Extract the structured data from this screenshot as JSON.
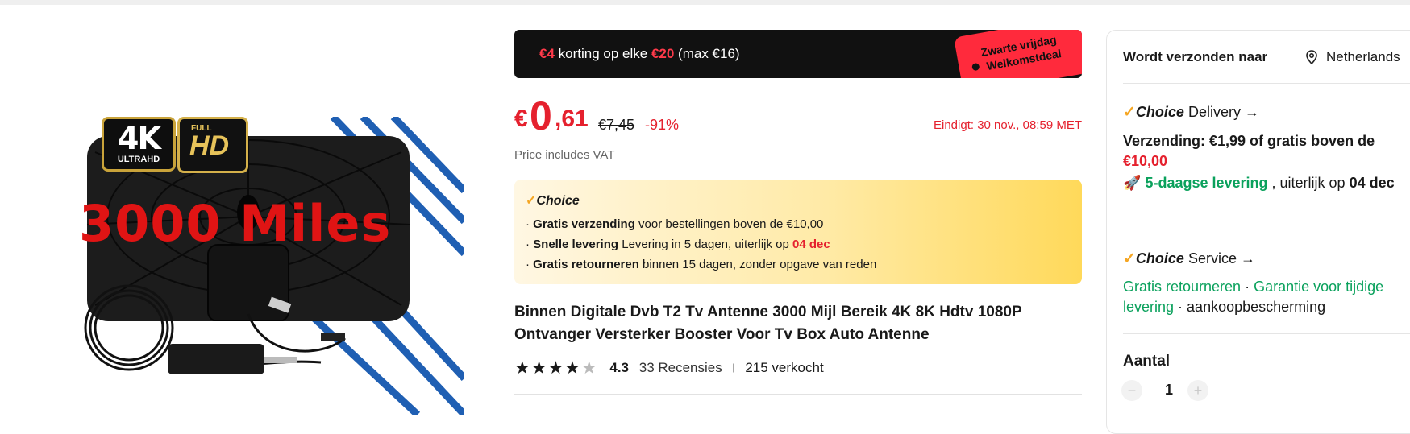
{
  "promo": {
    "amount": "€4",
    "text_mid": " korting op elke ",
    "threshold": "€20",
    "text_end": " (max €16)",
    "tag_line1": "Zwarte vrijdag",
    "tag_line2": "Welkomstdeal"
  },
  "product_image": {
    "badge_4k": "4K",
    "badge_ultrahd": "ULTRAHD",
    "badge_full": "FULL",
    "badge_hd": "HD",
    "overlay_text": "3000 Miles"
  },
  "price": {
    "currency": "€",
    "integer": "0",
    "decimal": ",61",
    "original": "€7,45",
    "discount": "-91%",
    "ends": "Eindigt: 30 nov., 08:59 MET",
    "vat_note": "Price includes VAT"
  },
  "choice_box": {
    "title": "Choice",
    "line1_bold": "Gratis verzending",
    "line1_rest": " voor bestellingen boven de €10,00",
    "line2_bold": "Snelle levering",
    "line2_rest": " Levering in 5 dagen, uiterlijk op ",
    "line2_date": "04 dec",
    "line3_bold": "Gratis retourneren",
    "line3_rest": "  binnen 15 dagen, zonder opgave van reden"
  },
  "product": {
    "title": "Binnen Digitale Dvb T2 Tv Antenne 3000 Mijl Bereik 4K 8K Hdtv 1080P Ontvanger Versterker Booster Voor Tv Box Auto Antenne",
    "rating": 4.3,
    "rating_text": "4.3",
    "reviews": "33 Recensies",
    "sold": "215 verkocht"
  },
  "shipping_panel": {
    "ship_to_label": "Wordt verzonden naar",
    "country": "Netherlands",
    "delivery_choice": "Choice",
    "delivery_label": " Delivery",
    "shipping_cost": "Verzending: €1,99  of gratis boven de ",
    "free_threshold": "€10,00",
    "fast_delivery": "5-daagse levering",
    "fast_delivery_rest": " , uiterlijk op ",
    "fast_date": "04",
    "fast_date_2": "dec",
    "service_choice": "Choice",
    "service_label": " Service",
    "service_free_returns": "Gratis retourneren",
    "service_guarantee": "Garantie voor tijdige levering",
    "service_protection": "aankoopbescherming",
    "quantity_label": "Aantal",
    "quantity": "1"
  },
  "colors": {
    "price_red": "#e5212e",
    "green": "#0aa15c",
    "choice_check": "#f5a623",
    "promo_bg": "#111111",
    "tag_red": "#ff2a3c"
  }
}
